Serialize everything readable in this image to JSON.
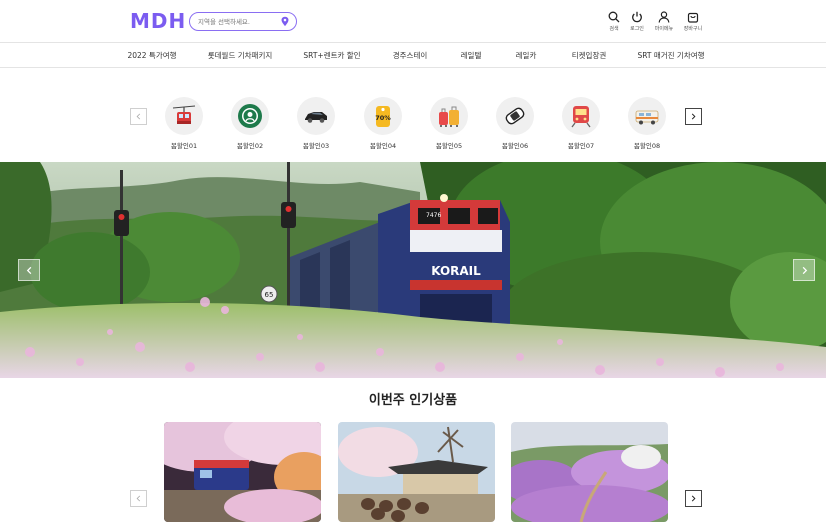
{
  "header": {
    "logo": "MDH",
    "search_placeholder": "지역을 선택하세요.",
    "utils": [
      {
        "icon": "search-icon",
        "label": "검색"
      },
      {
        "icon": "power-icon",
        "label": "로그인"
      },
      {
        "icon": "user-icon",
        "label": "마이메뉴"
      },
      {
        "icon": "cart-icon",
        "label": "장바구니"
      }
    ]
  },
  "nav": {
    "items": [
      {
        "label": "2022 특가여행"
      },
      {
        "label": "롯데월드 기차패키지"
      },
      {
        "label": "SRT+렌트카 할인"
      },
      {
        "label": "경주스테이"
      },
      {
        "label": "레일텔"
      },
      {
        "label": "레일카"
      },
      {
        "label": "티켓입장권"
      },
      {
        "label": "SRT 매거진 기차여행"
      }
    ]
  },
  "categories": [
    {
      "label": "봄할인01",
      "icon": "cable-car-icon"
    },
    {
      "label": "봄할인02",
      "icon": "coffee-logo-icon"
    },
    {
      "label": "봄할인03",
      "icon": "sports-car-icon"
    },
    {
      "label": "봄할인04",
      "icon": "discount-tag-icon",
      "tag": "70%"
    },
    {
      "label": "봄할인05",
      "icon": "luggage-icon"
    },
    {
      "label": "봄할인06",
      "icon": "car-icon"
    },
    {
      "label": "봄할인07",
      "icon": "train-icon"
    },
    {
      "label": "봄할인08",
      "icon": "camper-van-icon"
    }
  ],
  "banner": {
    "train_logo": "KORAIL",
    "train_number": "7476",
    "sign_number": "65"
  },
  "popular": {
    "title": "이번주 인기상품",
    "products": [
      {
        "name": "cherry-blossom-train"
      },
      {
        "name": "hanok-village"
      },
      {
        "name": "azalea-hill"
      }
    ]
  },
  "colors": {
    "brand": "#7b5cf0",
    "nav_border": "#e4e4e4"
  }
}
